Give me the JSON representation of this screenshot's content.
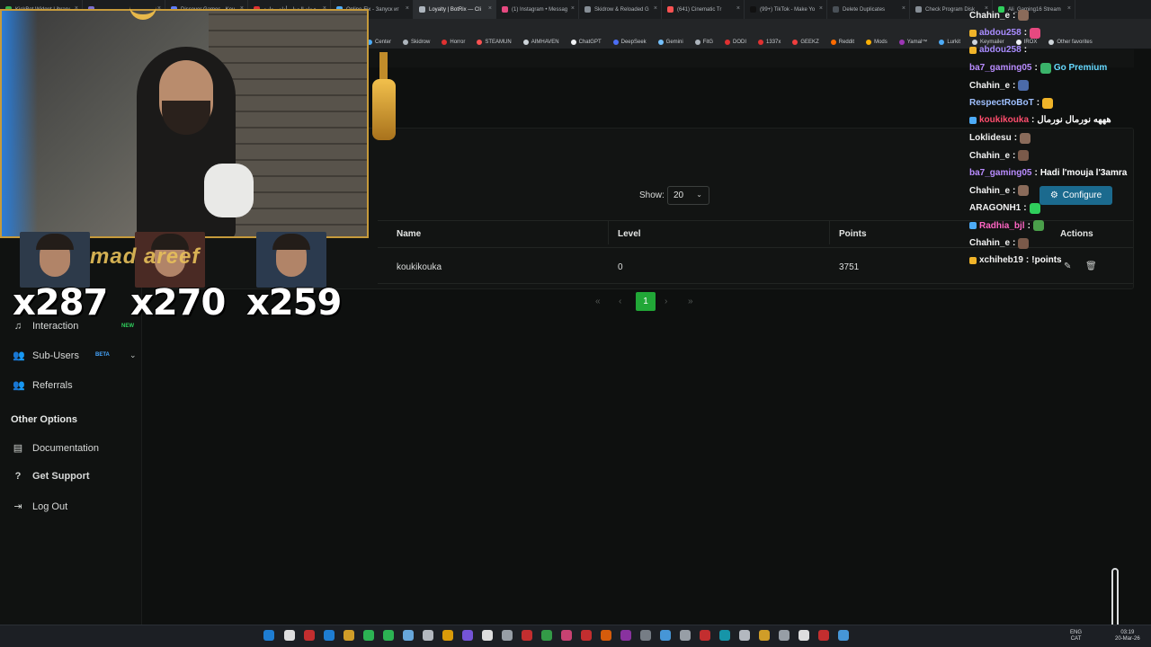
{
  "browser": {
    "tabs": [
      {
        "title": "KickBot Widget Library",
        "color": "#37b24d",
        "active": false
      },
      {
        "title": "",
        "color": "#7a6fd0",
        "active": false
      },
      {
        "title": "Discover Games - Key",
        "color": "#5c7cfa",
        "active": false
      },
      {
        "title": "عجلة الحظ - أداة مجانية",
        "color": "#e03131",
        "active": false
      },
      {
        "title": "Online-Fix - Запуск иг",
        "color": "#4dabf7",
        "active": false
      },
      {
        "title": "Loyalty | BotRix — Cli",
        "color": "#adb5bd",
        "active": true
      },
      {
        "title": "(1) Instagram • Messag",
        "color": "#e64980",
        "active": false
      },
      {
        "title": "Skidrow & Reloaded G",
        "color": "#868e96",
        "active": false
      },
      {
        "title": "(641) Cinematic Tr",
        "color": "#fa5252",
        "active": false
      },
      {
        "title": "(99+) TikTok - Make Yo",
        "color": "#111111",
        "active": false
      },
      {
        "title": "Delete Duplicates",
        "color": "#495057",
        "active": false
      },
      {
        "title": "Check Program Disk",
        "color": "#868e96",
        "active": false
      },
      {
        "title": "Ali_Gaming16 Stream",
        "color": "#2fce5c",
        "active": false
      }
    ],
    "bookmarks": [
      {
        "label": "Center",
        "color": "#4dabf7"
      },
      {
        "label": "Skidrow",
        "color": "#adb5bd"
      },
      {
        "label": "Horror",
        "color": "#e03131"
      },
      {
        "label": "STEAMUN",
        "color": "#fa5252"
      },
      {
        "label": "AIMHAVEN",
        "color": "#ced4da"
      },
      {
        "label": "ChatGPT",
        "color": "#f1f3f5"
      },
      {
        "label": "DeepSeek",
        "color": "#4c6ef5"
      },
      {
        "label": "Gemini",
        "color": "#74c0fc"
      },
      {
        "label": "FitG",
        "color": "#adb5bd"
      },
      {
        "label": "DODI",
        "color": "#e03131"
      },
      {
        "label": "1337x",
        "color": "#e03131"
      },
      {
        "label": "GEEKZ",
        "color": "#f03e3e"
      },
      {
        "label": "Reddit",
        "color": "#ff6b00"
      },
      {
        "label": "Mods",
        "color": "#fab005"
      },
      {
        "label": "Yamal™",
        "color": "#9c36b5"
      },
      {
        "label": "Lurkit",
        "color": "#4dabf7"
      },
      {
        "label": "Keymailer",
        "color": "#ced4da"
      },
      {
        "label": "IROX",
        "color": "#f1f3f5"
      },
      {
        "label": "Other favorites",
        "color": "#ced4da"
      }
    ]
  },
  "sidebar": {
    "items": [
      {
        "label": "Interaction",
        "icon": "music-note-icon",
        "badge": "NEW"
      },
      {
        "label": "Sub-Users",
        "icon": "users-icon",
        "badge": "BETA"
      },
      {
        "label": "Referrals",
        "icon": "referrals-icon"
      }
    ],
    "other_heading": "Other Options",
    "other_items": [
      {
        "label": "Documentation",
        "icon": "document-icon"
      },
      {
        "label": "Get Support",
        "icon": "question-icon"
      },
      {
        "label": "Log Out",
        "icon": "logout-icon"
      }
    ]
  },
  "loyalty": {
    "show_label": "Show:",
    "show_value": "20",
    "configure_label": "Configure",
    "columns": [
      "Name",
      "Level",
      "Points",
      "Actions"
    ],
    "rows": [
      {
        "name": "koukikouka",
        "level": "0",
        "points": "3751"
      }
    ],
    "pagination": {
      "first": "«",
      "prev": "‹",
      "current": "1",
      "next": "›",
      "last": "»"
    }
  },
  "stream_overlay": {
    "multipliers": [
      "x287",
      "x270",
      "x259"
    ],
    "banner_text": "mad    areef"
  },
  "chat": [
    {
      "user": "Chahin_e",
      "text": "",
      "color": "#f2f2f2",
      "emote": "#8a6b5a"
    },
    {
      "user": "abdou258",
      "text": "",
      "color": "#a98cff",
      "emote": "#e64980",
      "prefix": "#f0b429"
    },
    {
      "user": "abdou258",
      "text": "",
      "color": "#a98cff",
      "emote": "",
      "prefix": "#f0b429"
    },
    {
      "user": "ba7_gaming05",
      "text": "Go Premium",
      "color": "#b98cff",
      "emote": "#3ab36a",
      "text_color": "#66d9ff"
    },
    {
      "user": "Chahin_e",
      "text": "",
      "color": "#f2f2f2",
      "emote": "#4b6aa8"
    },
    {
      "user": "RespectRoBoT",
      "text": "",
      "color": "#9fc0ff",
      "emote": "#f0b429"
    },
    {
      "user": "koukikouka",
      "text": "هههه نورمال نورمال",
      "color": "#ff4d6d",
      "emote": "",
      "prefix": "#4dabf7"
    },
    {
      "user": "Loklidesu",
      "text": "",
      "color": "#f2f2f2",
      "emote": "#8a6b5a"
    },
    {
      "user": "Chahin_e",
      "text": "",
      "color": "#f2f2f2",
      "emote": "#7a5a4a"
    },
    {
      "user": "ba7_gaming05",
      "text": "Hadi l'mouja l'3amra",
      "color": "#b98cff",
      "emote": ""
    },
    {
      "user": "Chahin_e",
      "text": "",
      "color": "#f2f2f2",
      "emote": "#8a6b5a"
    },
    {
      "user": "ARAGONH1",
      "text": "",
      "color": "#f2f2f2",
      "emote": "#2fce5c"
    },
    {
      "user": "Radhia_bjl",
      "text": "",
      "color": "#ff66c4",
      "emote": "#4a9f4a",
      "prefix": "#4dabf7"
    },
    {
      "user": "Chahin_e",
      "text": "",
      "color": "#f2f2f2",
      "emote": "#7a5a4a"
    },
    {
      "user": "xchiheb19",
      "text": "!points",
      "color": "#f2f2f2",
      "emote": "",
      "prefix": "#f0b429"
    }
  ],
  "taskbar": {
    "lang_top": "ENG",
    "lang_bottom": "CAT",
    "time": "03:19",
    "date": "20-Mar-26"
  }
}
